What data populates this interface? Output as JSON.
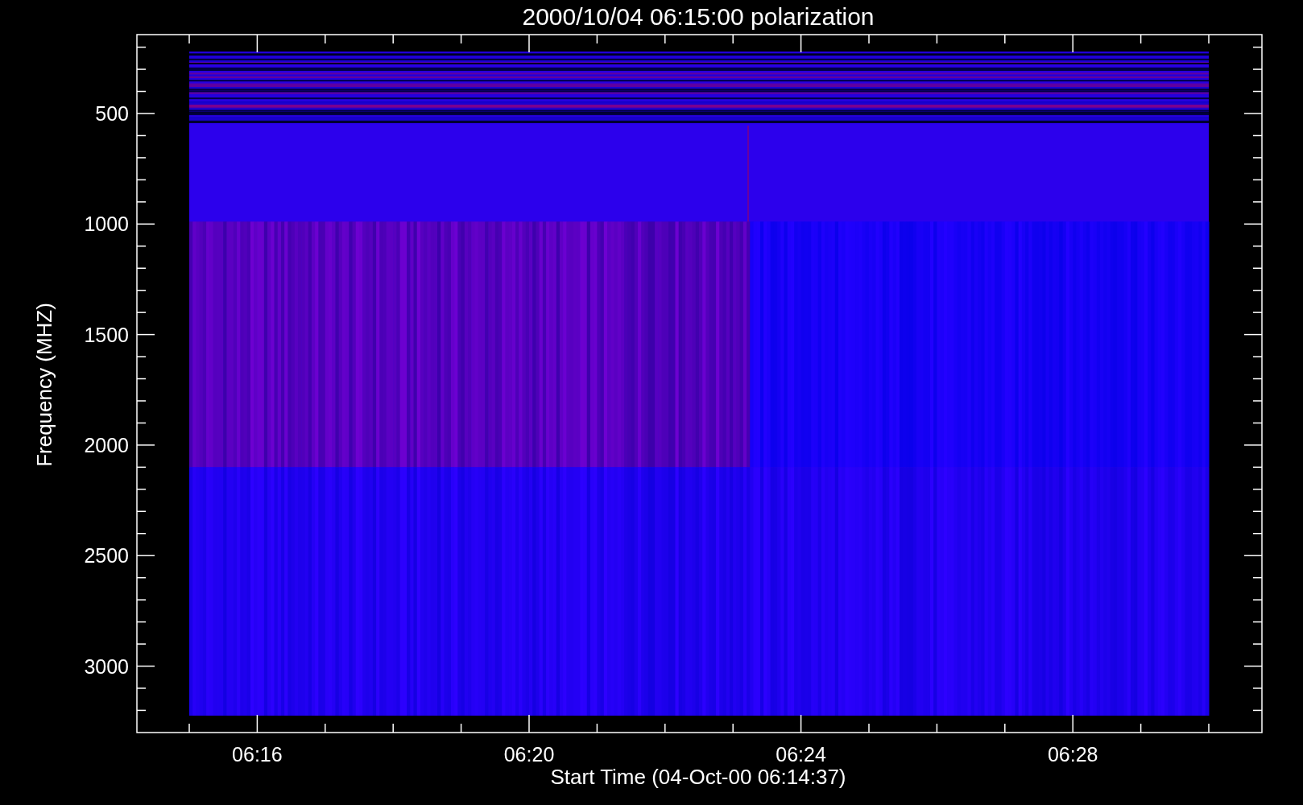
{
  "title": "2000/10/04 06:15:00 polarization",
  "xlabel": "Start Time (04-Oct-00 06:14:37)",
  "ylabel": "Frequency (MHZ)",
  "yticks": [
    "500",
    "1000",
    "1500",
    "2000",
    "2500",
    "3000"
  ],
  "xticks": [
    "06:16",
    "06:20",
    "06:24",
    "06:28"
  ]
}
